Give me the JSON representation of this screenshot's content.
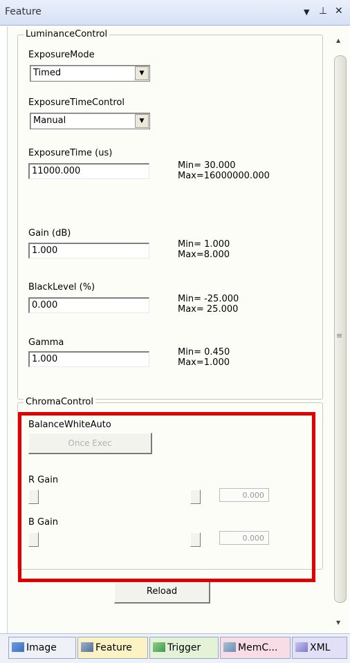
{
  "window": {
    "title": "Feature",
    "controls": {
      "dropdown": "▼",
      "pin": "⊥",
      "close": "✕"
    }
  },
  "luminance": {
    "legend": "LuminanceControl",
    "exposure_mode": {
      "label": "ExposureMode",
      "value": "Timed"
    },
    "exposure_time_control": {
      "label": "ExposureTimeControl",
      "value": "Manual"
    },
    "exposure_time": {
      "label": "ExposureTime (us)",
      "value": "11000.000",
      "min": "Min= 30.000",
      "max": "Max=16000000.000"
    },
    "gain": {
      "label": "Gain (dB)",
      "value": "1.000",
      "min": "Min= 1.000",
      "max": "Max=8.000"
    },
    "black_level": {
      "label": "BlackLevel (%)",
      "value": "0.000",
      "min": "Min= -25.000",
      "max": "Max= 25.000"
    },
    "gamma": {
      "label": "Gamma",
      "value": "1.000",
      "min": "Min= 0.450",
      "max": "Max=1.000"
    }
  },
  "chroma": {
    "legend": "ChromaControl",
    "balance_white_auto": {
      "label": "BalanceWhiteAuto",
      "button": "Once Exec"
    },
    "r_gain": {
      "label": "R Gain",
      "value": "0.000"
    },
    "b_gain": {
      "label": "B Gain",
      "value": "0.000"
    }
  },
  "reload_label": "Reload",
  "scrollbar": {
    "up": "▲",
    "grip": "≡",
    "down": "▼"
  },
  "tabs": [
    {
      "label": "Image",
      "color": "#eef1f8"
    },
    {
      "label": "Feature",
      "color": "#fbf3c4"
    },
    {
      "label": "Trigger",
      "color": "#e4f3d7"
    },
    {
      "label": "MemC...",
      "color": "#f8dde6"
    },
    {
      "label": "XML",
      "color": "#e2e0f6"
    }
  ],
  "highlight_color": "#e00000"
}
